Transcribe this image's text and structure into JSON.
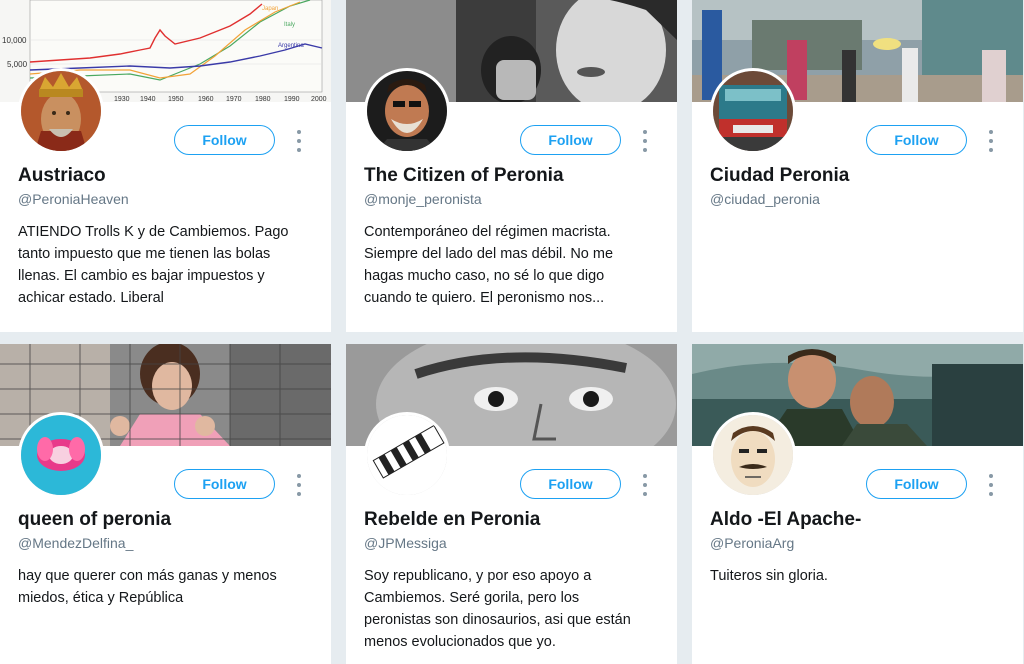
{
  "follow_label": "Follow",
  "chart_banner": {
    "y_ticks": [
      "10,000",
      "5,000"
    ],
    "x_ticks": [
      "1930",
      "1940",
      "1950",
      "1960",
      "1970",
      "1980",
      "1990",
      "2000"
    ],
    "series_labels": [
      "Japan",
      "Italy",
      "Argentina"
    ]
  },
  "cards": [
    {
      "name": "Austriaco",
      "handle": "@PeroniaHeaven",
      "bio": [
        "ATIENDO Trolls K y de Cambiemos. Pago",
        "tanto impuesto que me tienen las bolas",
        "llenas. El cambio es bajar impuestos y",
        "achicar estado. Liberal"
      ]
    },
    {
      "name": "The Citizen of Peronia",
      "handle": "@monje_peronista",
      "bio": [
        "Contemporáneo del régimen macrista.",
        "Siempre del lado del mas débil. No me",
        "hagas mucho caso, no sé lo que digo",
        "cuando te quiero. El peronismo nos..."
      ]
    },
    {
      "name": "Ciudad Peronia",
      "handle": "@ciudad_peronia",
      "bio": []
    },
    {
      "name": "queen of peronia",
      "handle": "@MendezDelfina_",
      "bio": [
        "hay que querer con más ganas y menos",
        "miedos, ética y República"
      ]
    },
    {
      "name": "Rebelde en Peronia",
      "handle": "@JPMessiga",
      "bio": [
        "Soy republicano, y por eso apoyo a",
        "Cambiemos. Seré gorila, pero los",
        "peronistas son dinosaurios, asi que están",
        "menos evolucionados que yo."
      ]
    },
    {
      "name": "Aldo -El Apache-",
      "handle": "@PeroniaArg",
      "bio": [
        "Tuiteros sin gloria."
      ]
    }
  ],
  "colors": {
    "accent": "#1da1f2",
    "background": "#e6ecf0",
    "muted": "#657786"
  },
  "icons": {
    "more": "more-vertical-icon"
  }
}
